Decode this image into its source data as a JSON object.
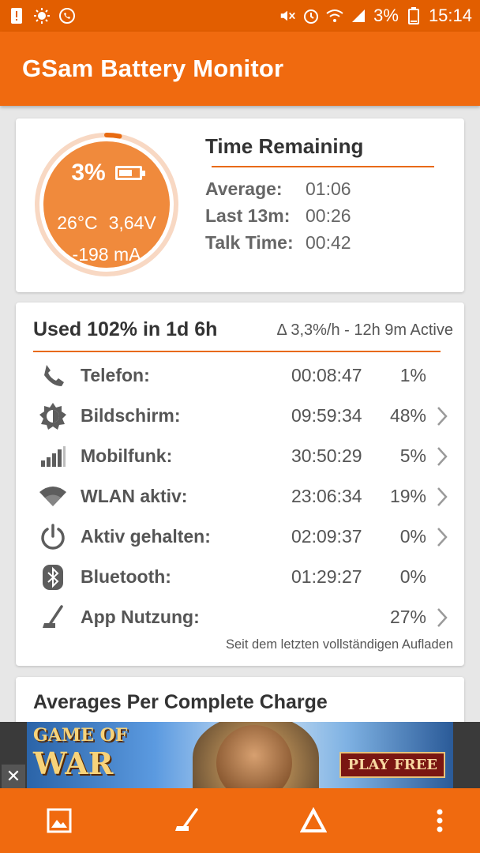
{
  "status_bar": {
    "battery_percent": "3%",
    "time": "15:14",
    "left_icons": [
      "alert-icon",
      "brightness-icon",
      "whatsapp-icon"
    ],
    "right_icons": [
      "mute-icon",
      "alarm-icon",
      "wifi-icon",
      "signal-icon",
      "battery-icon"
    ]
  },
  "app": {
    "title": "GSam Battery Monitor",
    "accent_color": "#f06a0f"
  },
  "battery": {
    "percent": "3%",
    "level": 0.03,
    "temperature": "26°C",
    "voltage": "3,64V",
    "current": "-198 mA"
  },
  "time_remaining": {
    "title": "Time Remaining",
    "rows": [
      {
        "label": "Average:",
        "value": "01:06"
      },
      {
        "label": "Last 13m:",
        "value": "00:26"
      },
      {
        "label": "Talk Time:",
        "value": "00:42"
      }
    ]
  },
  "usage": {
    "title": "Used 102% in 1d 6h",
    "subtitle": "Δ 3,3%/h - 12h 9m Active",
    "rows": [
      {
        "icon": "phone-icon",
        "label": "Telefon:",
        "time": "00:08:47",
        "percent": "1%",
        "has_chevron": false
      },
      {
        "icon": "brightness-icon",
        "label": "Bildschirm:",
        "time": "09:59:34",
        "percent": "48%",
        "has_chevron": true
      },
      {
        "icon": "cell-signal-icon",
        "label": "Mobilfunk:",
        "time": "30:50:29",
        "percent": "5%",
        "has_chevron": true
      },
      {
        "icon": "wifi-icon",
        "label": "WLAN aktiv:",
        "time": "23:06:34",
        "percent": "19%",
        "has_chevron": true
      },
      {
        "icon": "power-icon",
        "label": "Aktiv gehalten:",
        "time": "02:09:37",
        "percent": "0%",
        "has_chevron": true
      },
      {
        "icon": "bluetooth-icon",
        "label": "Bluetooth:",
        "time": "01:29:27",
        "percent": "0%",
        "has_chevron": false
      },
      {
        "icon": "app-usage-icon",
        "label": "App Nutzung:",
        "time": "",
        "percent": "27%",
        "has_chevron": true
      }
    ],
    "footer": "Seit dem letzten vollständigen Aufladen"
  },
  "averages": {
    "title": "Averages Per Complete Charge"
  },
  "ad": {
    "line1": "GAME OF",
    "line2": "WAR",
    "button": "PLAY FREE",
    "close_label": "✕"
  },
  "bottom_bar": {
    "buttons": [
      "image-icon",
      "app-usage-icon",
      "delta-icon",
      "more-vert-icon"
    ]
  }
}
